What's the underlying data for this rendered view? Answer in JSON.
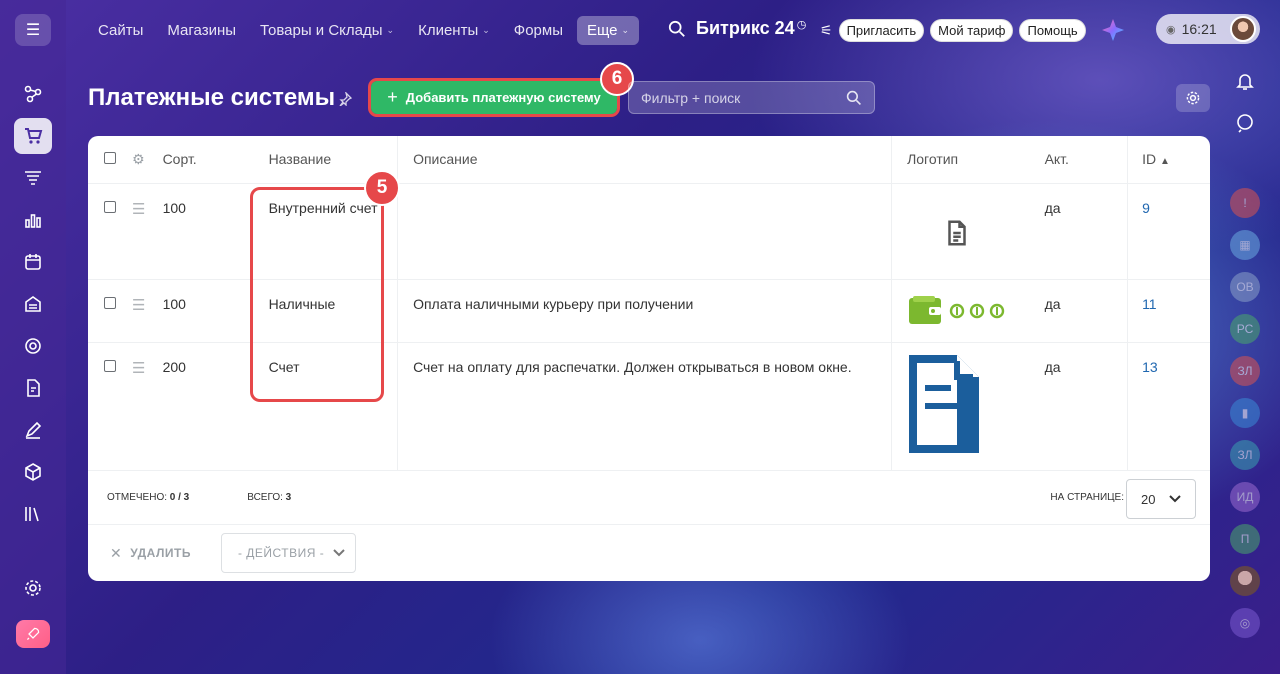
{
  "topnav": {
    "items": [
      {
        "label": "Сайты",
        "chevron": false
      },
      {
        "label": "Магазины",
        "chevron": false
      },
      {
        "label": "Товары и Склады",
        "chevron": true
      },
      {
        "label": "Клиенты",
        "chevron": true
      },
      {
        "label": "Формы",
        "chevron": false
      },
      {
        "label": "Еще",
        "chevron": true,
        "active": true
      }
    ],
    "brand": "Битрикс 24",
    "invite": "Пригласить",
    "tariff": "Мой тариф",
    "help": "Помощь",
    "time": "16:21"
  },
  "page": {
    "title": "Платежные системы",
    "add_button": "Добавить платежную систему",
    "filter_placeholder": "Фильтр + поиск"
  },
  "callouts": {
    "five": "5",
    "six": "6"
  },
  "table": {
    "headers": {
      "sort": "Сорт.",
      "name": "Название",
      "description": "Описание",
      "logo": "Логотип",
      "active": "Акт.",
      "id": "ID"
    },
    "rows": [
      {
        "sort": "100",
        "name": "Внутренний счет",
        "description": "",
        "logo": "document-icon",
        "active": "да",
        "id": "9"
      },
      {
        "sort": "100",
        "name": "Наличные",
        "description": "Оплата наличными курьеру при получении",
        "logo": "wallet-icon",
        "active": "да",
        "id": "11"
      },
      {
        "sort": "200",
        "name": "Счет",
        "description": "Счет на оплату для распечатки. Должен открываться в новом окне.",
        "logo": "invoice-icon",
        "active": "да",
        "id": "13"
      }
    ]
  },
  "footer": {
    "checked_label": "ОТМЕЧЕНО:",
    "checked_value": "0 / 3",
    "total_label": "ВСЕГО:",
    "total_value": "3",
    "per_page_label": "НА СТРАНИЦЕ:",
    "per_page_value": "20",
    "delete_label": "УДАЛИТЬ",
    "actions_label": "- ДЕЙСТВИЯ -"
  },
  "right_sidebar": {
    "avatars": [
      "ОВ",
      "РС",
      "ЗЛ",
      "ЗЛ",
      "ИД",
      "П"
    ]
  },
  "colors": {
    "accent_green": "#2fb866",
    "callout_red": "#e6484a",
    "link_blue": "#2067b0"
  }
}
